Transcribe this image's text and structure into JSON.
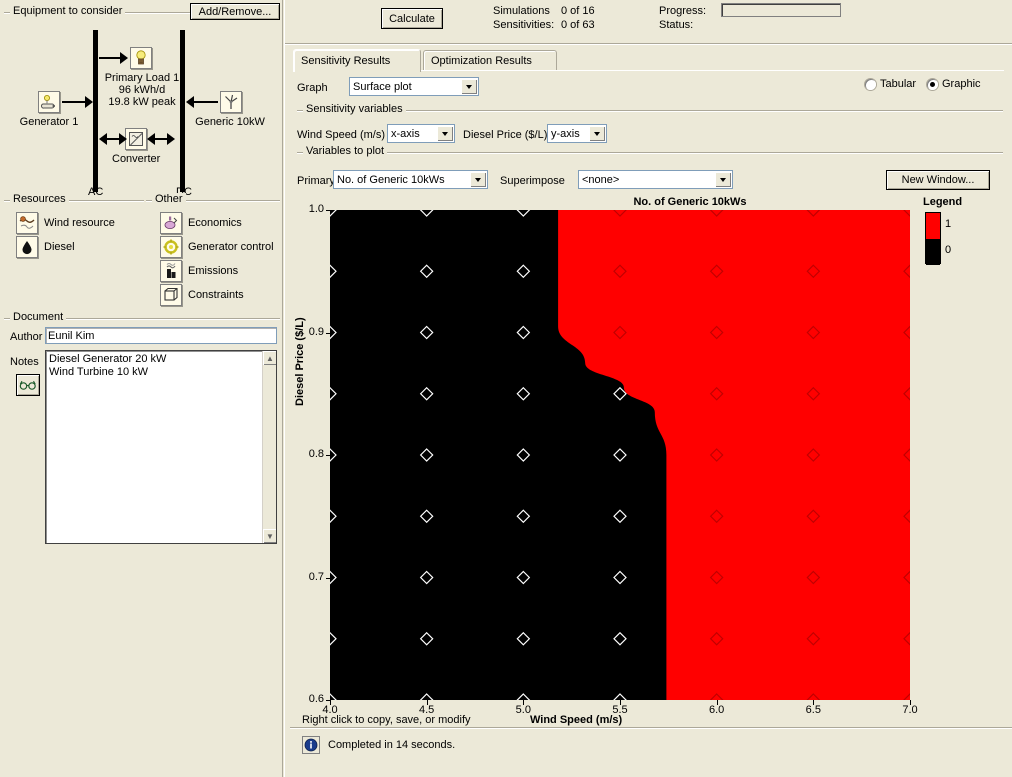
{
  "left": {
    "equipment": {
      "group_title": "Equipment to consider",
      "add_remove_button": "Add/Remove...",
      "bus_ac": "AC",
      "bus_dc": "DC",
      "components": [
        {
          "name": "Generator 1",
          "icon": "generator-icon"
        },
        {
          "name": "Primary Load 1\n96 kWh/d\n19.8 kW peak",
          "icon": "load-icon"
        },
        {
          "name": "Generic 10kW",
          "icon": "wind-turbine-icon"
        },
        {
          "name": "Converter",
          "icon": "converter-icon"
        }
      ],
      "load_line1": "Primary Load 1",
      "load_line2": "96 kWh/d",
      "load_line3": "19.8 kW peak"
    },
    "resources": {
      "group_title": "Resources",
      "items": [
        {
          "label": "Wind resource",
          "icon": "wind-resource-icon"
        },
        {
          "label": "Diesel",
          "icon": "diesel-drop-icon"
        }
      ]
    },
    "other": {
      "group_title": "Other",
      "items": [
        {
          "label": "Economics",
          "icon": "economics-icon"
        },
        {
          "label": "Generator control",
          "icon": "generator-control-icon"
        },
        {
          "label": "Emissions",
          "icon": "emissions-icon"
        },
        {
          "label": "Constraints",
          "icon": "constraints-icon"
        }
      ]
    },
    "document": {
      "group_title": "Document",
      "author_label": "Author",
      "author_value": "Eunil Kim",
      "notes_label": "Notes",
      "notes_value": "Diesel Generator 20 kW\nWind Turbine 10 kW",
      "glasses_button": "glasses-icon"
    }
  },
  "toolbar": {
    "calculate_label": "Calculate",
    "simulations_label": "Simulations",
    "simulations_value": "0 of 16",
    "sensitivities_label": "Sensitivities:",
    "sensitivities_value": "0 of 63",
    "progress_label": "Progress:",
    "status_label": "Status:",
    "progress_value": ""
  },
  "tabs": [
    {
      "label": "Sensitivity Results",
      "active": true
    },
    {
      "label": "Optimization Results",
      "active": false
    }
  ],
  "controls": {
    "graph_label": "Graph",
    "graph_value": "Surface plot",
    "view_tabular": "Tabular",
    "view_graphic": "Graphic",
    "view_selected": "Graphic",
    "sensitivity_group": "Sensitivity variables",
    "sens_var_1_label": "Wind Speed (m/s)",
    "sens_var_1_value": "x-axis",
    "sens_var_2_label": "Diesel Price ($/L)",
    "sens_var_2_value": "y-axis",
    "plot_group": "Variables to plot",
    "primary_label": "Primary",
    "primary_value": "No. of Generic 10kWs",
    "superimpose_label": "Superimpose",
    "superimpose_value": "<none>",
    "new_window_button": "New Window..."
  },
  "colors": {
    "value_1": "#ff0000",
    "value_0": "#000000",
    "face": "#ece9d8",
    "border": "#aca899"
  },
  "chart_data": {
    "type": "heatmap",
    "title": "No. of Generic 10kWs",
    "xlabel": "Wind Speed (m/s)",
    "ylabel": "Diesel Price ($/L)",
    "xlim": [
      4.0,
      7.0
    ],
    "ylim": [
      0.6,
      1.0
    ],
    "xticks": [
      4.0,
      4.5,
      5.0,
      5.5,
      6.0,
      6.5,
      7.0
    ],
    "yticks": [
      0.6,
      0.7,
      0.8,
      0.9,
      1.0
    ],
    "grid": false,
    "legend_title": "Legend",
    "legend_position": "right",
    "legend_entries": [
      {
        "label": "1",
        "color": "#ff0000"
      },
      {
        "label": "0",
        "color": "#000000"
      }
    ],
    "marker": "diamond",
    "marker_x": [
      4.0,
      4.5,
      5.0,
      5.5,
      6.0,
      6.5,
      7.0
    ],
    "marker_y": [
      0.6,
      0.65,
      0.7,
      0.75,
      0.8,
      0.85,
      0.9,
      0.95,
      1.0
    ],
    "region_boundary_note": "Black (0) region left of boundary, red (1) region right",
    "boundary_points": [
      {
        "x": 5.18,
        "y": 1.0
      },
      {
        "x": 5.18,
        "y": 0.905
      },
      {
        "x": 5.32,
        "y": 0.875
      },
      {
        "x": 5.52,
        "y": 0.855
      },
      {
        "x": 5.68,
        "y": 0.835
      },
      {
        "x": 5.74,
        "y": 0.8
      },
      {
        "x": 5.74,
        "y": 0.6
      }
    ],
    "values": [
      {
        "y": 1.0,
        "row": [
          0,
          0,
          0,
          1,
          1,
          1,
          1
        ]
      },
      {
        "y": 0.95,
        "row": [
          0,
          0,
          0,
          1,
          1,
          1,
          1
        ]
      },
      {
        "y": 0.9,
        "row": [
          0,
          0,
          0,
          1,
          1,
          1,
          1
        ]
      },
      {
        "y": 0.85,
        "row": [
          0,
          0,
          0,
          0,
          1,
          1,
          1
        ]
      },
      {
        "y": 0.8,
        "row": [
          0,
          0,
          0,
          0,
          1,
          1,
          1
        ]
      },
      {
        "y": 0.75,
        "row": [
          0,
          0,
          0,
          0,
          1,
          1,
          1
        ]
      },
      {
        "y": 0.7,
        "row": [
          0,
          0,
          0,
          0,
          1,
          1,
          1
        ]
      },
      {
        "y": 0.65,
        "row": [
          0,
          0,
          0,
          0,
          1,
          1,
          1
        ]
      },
      {
        "y": 0.6,
        "row": [
          0,
          0,
          0,
          0,
          1,
          1,
          1
        ]
      }
    ],
    "hint": "Right click to copy, save, or modify"
  },
  "statusbar": {
    "message": "Completed in 14 seconds.",
    "icon": "info-icon"
  }
}
